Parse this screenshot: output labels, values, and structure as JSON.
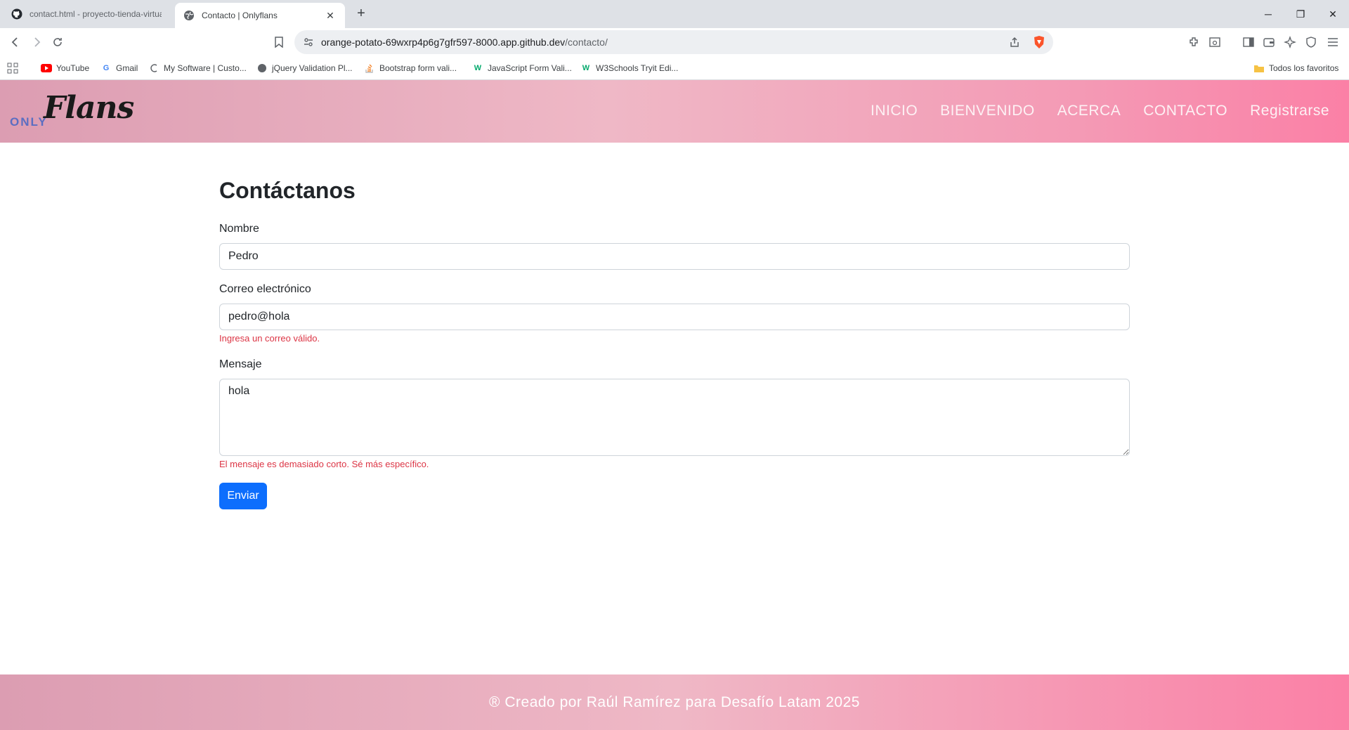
{
  "browser": {
    "tabs": [
      {
        "label": "contact.html - proyecto-tienda-virtua",
        "icon": "github-icon"
      },
      {
        "label": "Contacto | Onlyflans",
        "icon": "globe-icon"
      }
    ],
    "address": {
      "host": "orange-potato-69wxrp4p6g7gfr597-8000.app.github.dev",
      "path": "/contacto/"
    },
    "bookmarks": [
      {
        "label": "YouTube",
        "icon": "youtube-icon"
      },
      {
        "label": "Gmail",
        "icon": "google-icon"
      },
      {
        "label": "My Software | Custo...",
        "icon": "software-icon"
      },
      {
        "label": "jQuery Validation Pl...",
        "icon": "globe-icon"
      },
      {
        "label": "Bootstrap form vali...",
        "icon": "stackoverflow-icon"
      },
      {
        "label": "JavaScript Form Vali...",
        "icon": "w3schools-icon"
      },
      {
        "label": "W3Schools Tryit Edi...",
        "icon": "w3schools-icon"
      }
    ],
    "all_bookmarks_label": "Todos los favoritos"
  },
  "site": {
    "logo": {
      "small": "ONLY",
      "script": "Flans"
    },
    "nav": [
      "INICIO",
      "BIENVENIDO",
      "ACERCA",
      "CONTACTO",
      "Registrarse"
    ],
    "footer": "® Creado por Raúl Ramírez para Desafío Latam 2025"
  },
  "form": {
    "title": "Contáctanos",
    "name_label": "Nombre",
    "name_value": "Pedro",
    "email_label": "Correo electrónico",
    "email_value": "pedro@hola",
    "email_error": "Ingresa un correo válido.",
    "message_label": "Mensaje",
    "message_value": "hola",
    "message_error": "El mensaje es demasiado corto. Sé más específico.",
    "submit_label": "Enviar"
  },
  "colors": {
    "primary_button": "#0d6efd",
    "error": "#dc3545",
    "header_gradient_start": "#dc9db2",
    "header_gradient_end": "#fb80a6"
  }
}
